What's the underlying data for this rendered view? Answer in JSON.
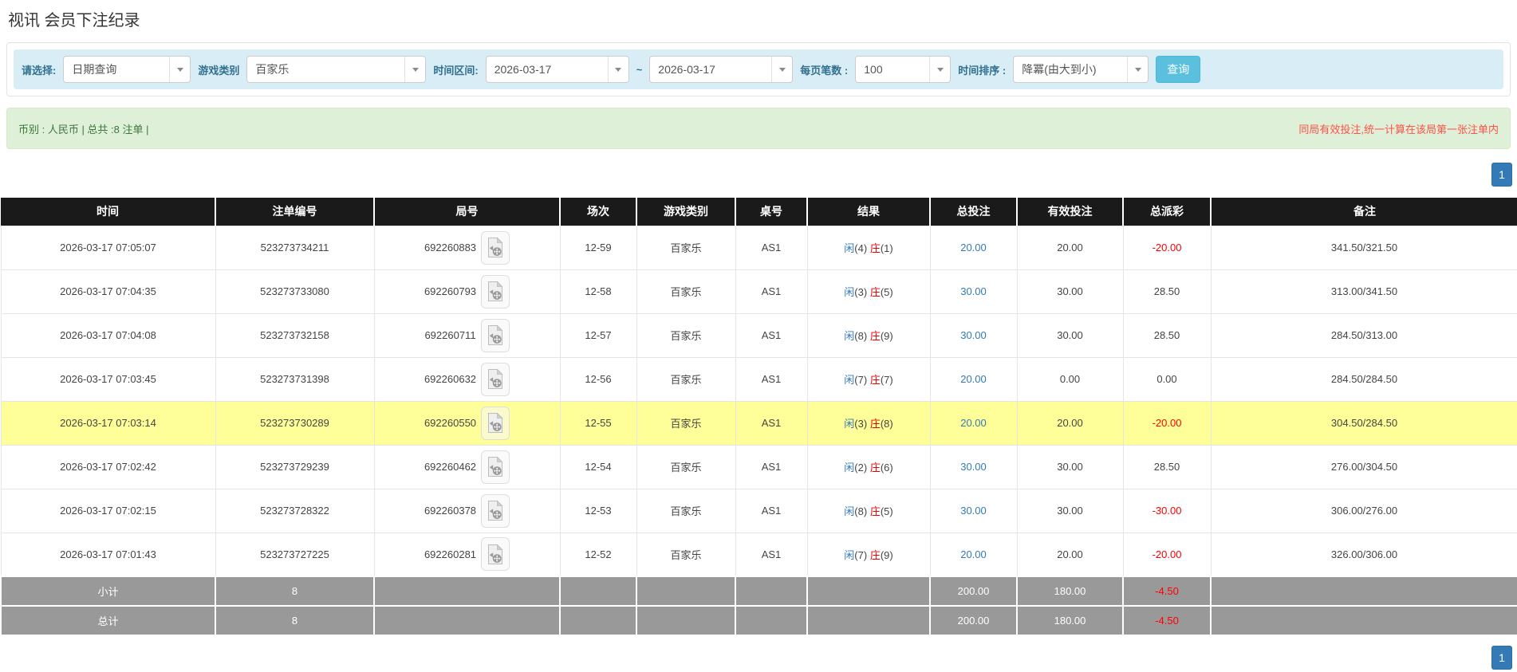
{
  "page": {
    "title": "视讯 会员下注纪录"
  },
  "filters": {
    "select_label": "请选择:",
    "select_value": "日期查询",
    "game_type_label": "游戏类别",
    "game_type_value": "百家乐",
    "date_range_label": "时间区间:",
    "date_from": "2026-03-17",
    "range_separator": "~",
    "date_to": "2026-03-17",
    "page_size_label": "每页笔数 :",
    "page_size_value": "100",
    "sort_label": "时间排序 :",
    "sort_value": "降冪(由大到小)",
    "search_button": "查询"
  },
  "summary": {
    "left_text": "币别 : 人民币 | 总共 :8 注单 |",
    "right_note": "同局有效投注,统一计算在该局第一张注单内"
  },
  "pagination": {
    "page": "1"
  },
  "table": {
    "headers": [
      "时间",
      "注单编号",
      "局号",
      "场次",
      "游戏类别",
      "桌号",
      "结果",
      "总投注",
      "有效投注",
      "总派彩",
      "备注"
    ],
    "rows": [
      {
        "time": "2026-03-17 07:05:07",
        "bet_id": "523273734211",
        "round": "692260883",
        "session": "12-59",
        "game": "百家乐",
        "table_no": "AS1",
        "result_p": "闲",
        "result_p_n": "(4)",
        "result_b": "庄",
        "result_b_n": "(1)",
        "total_bet": "20.00",
        "valid_bet": "20.00",
        "payout": "-20.00",
        "remark": "341.50/321.50",
        "highlight": false
      },
      {
        "time": "2026-03-17 07:04:35",
        "bet_id": "523273733080",
        "round": "692260793",
        "session": "12-58",
        "game": "百家乐",
        "table_no": "AS1",
        "result_p": "闲",
        "result_p_n": "(3)",
        "result_b": "庄",
        "result_b_n": "(5)",
        "total_bet": "30.00",
        "valid_bet": "30.00",
        "payout": "28.50",
        "remark": "313.00/341.50",
        "highlight": false
      },
      {
        "time": "2026-03-17 07:04:08",
        "bet_id": "523273732158",
        "round": "692260711",
        "session": "12-57",
        "game": "百家乐",
        "table_no": "AS1",
        "result_p": "闲",
        "result_p_n": "(8)",
        "result_b": "庄",
        "result_b_n": "(9)",
        "total_bet": "30.00",
        "valid_bet": "30.00",
        "payout": "28.50",
        "remark": "284.50/313.00",
        "highlight": false
      },
      {
        "time": "2026-03-17 07:03:45",
        "bet_id": "523273731398",
        "round": "692260632",
        "session": "12-56",
        "game": "百家乐",
        "table_no": "AS1",
        "result_p": "闲",
        "result_p_n": "(7)",
        "result_b": "庄",
        "result_b_n": "(7)",
        "total_bet": "20.00",
        "valid_bet": "0.00",
        "payout": "0.00",
        "remark": "284.50/284.50",
        "highlight": false
      },
      {
        "time": "2026-03-17 07:03:14",
        "bet_id": "523273730289",
        "round": "692260550",
        "session": "12-55",
        "game": "百家乐",
        "table_no": "AS1",
        "result_p": "闲",
        "result_p_n": "(3)",
        "result_b": "庄",
        "result_b_n": "(8)",
        "total_bet": "20.00",
        "valid_bet": "20.00",
        "payout": "-20.00",
        "remark": "304.50/284.50",
        "highlight": true
      },
      {
        "time": "2026-03-17 07:02:42",
        "bet_id": "523273729239",
        "round": "692260462",
        "session": "12-54",
        "game": "百家乐",
        "table_no": "AS1",
        "result_p": "闲",
        "result_p_n": "(2)",
        "result_b": "庄",
        "result_b_n": "(6)",
        "total_bet": "30.00",
        "valid_bet": "30.00",
        "payout": "28.50",
        "remark": "276.00/304.50",
        "highlight": false
      },
      {
        "time": "2026-03-17 07:02:15",
        "bet_id": "523273728322",
        "round": "692260378",
        "session": "12-53",
        "game": "百家乐",
        "table_no": "AS1",
        "result_p": "闲",
        "result_p_n": "(8)",
        "result_b": "庄",
        "result_b_n": "(5)",
        "total_bet": "30.00",
        "valid_bet": "30.00",
        "payout": "-30.00",
        "remark": "306.00/276.00",
        "highlight": false
      },
      {
        "time": "2026-03-17 07:01:43",
        "bet_id": "523273727225",
        "round": "692260281",
        "session": "12-52",
        "game": "百家乐",
        "table_no": "AS1",
        "result_p": "闲",
        "result_p_n": "(7)",
        "result_b": "庄",
        "result_b_n": "(9)",
        "total_bet": "20.00",
        "valid_bet": "20.00",
        "payout": "-20.00",
        "remark": "326.00/306.00",
        "highlight": false
      }
    ],
    "subtotal": {
      "label": "小计",
      "count": "8",
      "total_bet": "200.00",
      "valid_bet": "180.00",
      "payout": "-4.50"
    },
    "total": {
      "label": "总计",
      "count": "8",
      "total_bet": "200.00",
      "valid_bet": "180.00",
      "payout": "-4.50"
    }
  },
  "colors": {
    "header_black": "#1a1a1a",
    "link_blue": "#337ab7",
    "player_blue": "#337ab7",
    "banker_red": "#e60000",
    "negative_red": "#ff0000",
    "highlight_yellow": "#ffff99",
    "totals_gray": "#999999",
    "filter_bar_blue": "#d9edf7",
    "summary_green_bg": "#dff0d8",
    "summary_green_text": "#3c763d",
    "summary_note_red": "#ff5147",
    "search_button_blue": "#5bc0de"
  }
}
